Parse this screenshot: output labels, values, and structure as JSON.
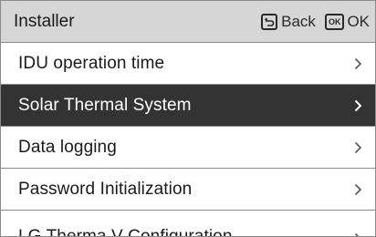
{
  "header": {
    "title": "Installer",
    "back_label": "Back",
    "ok_icon_text": "OK",
    "ok_label": "OK",
    "back_icon": "back-arrow-icon",
    "ok_icon": "ok-key-icon"
  },
  "menu": {
    "items": [
      {
        "label": "IDU operation time",
        "selected": false
      },
      {
        "label": "Solar Thermal System",
        "selected": true
      },
      {
        "label": "Data logging",
        "selected": false
      },
      {
        "label": "Password Initialization",
        "selected": false
      },
      {
        "label": "LG Therma V Configuration",
        "selected": false,
        "partially_visible": true
      }
    ],
    "chevron_icon": "chevron-right-icon"
  },
  "colors": {
    "header_bg": "#d6d6d6",
    "selected_bg": "#333333",
    "border": "#8a8a8a"
  }
}
